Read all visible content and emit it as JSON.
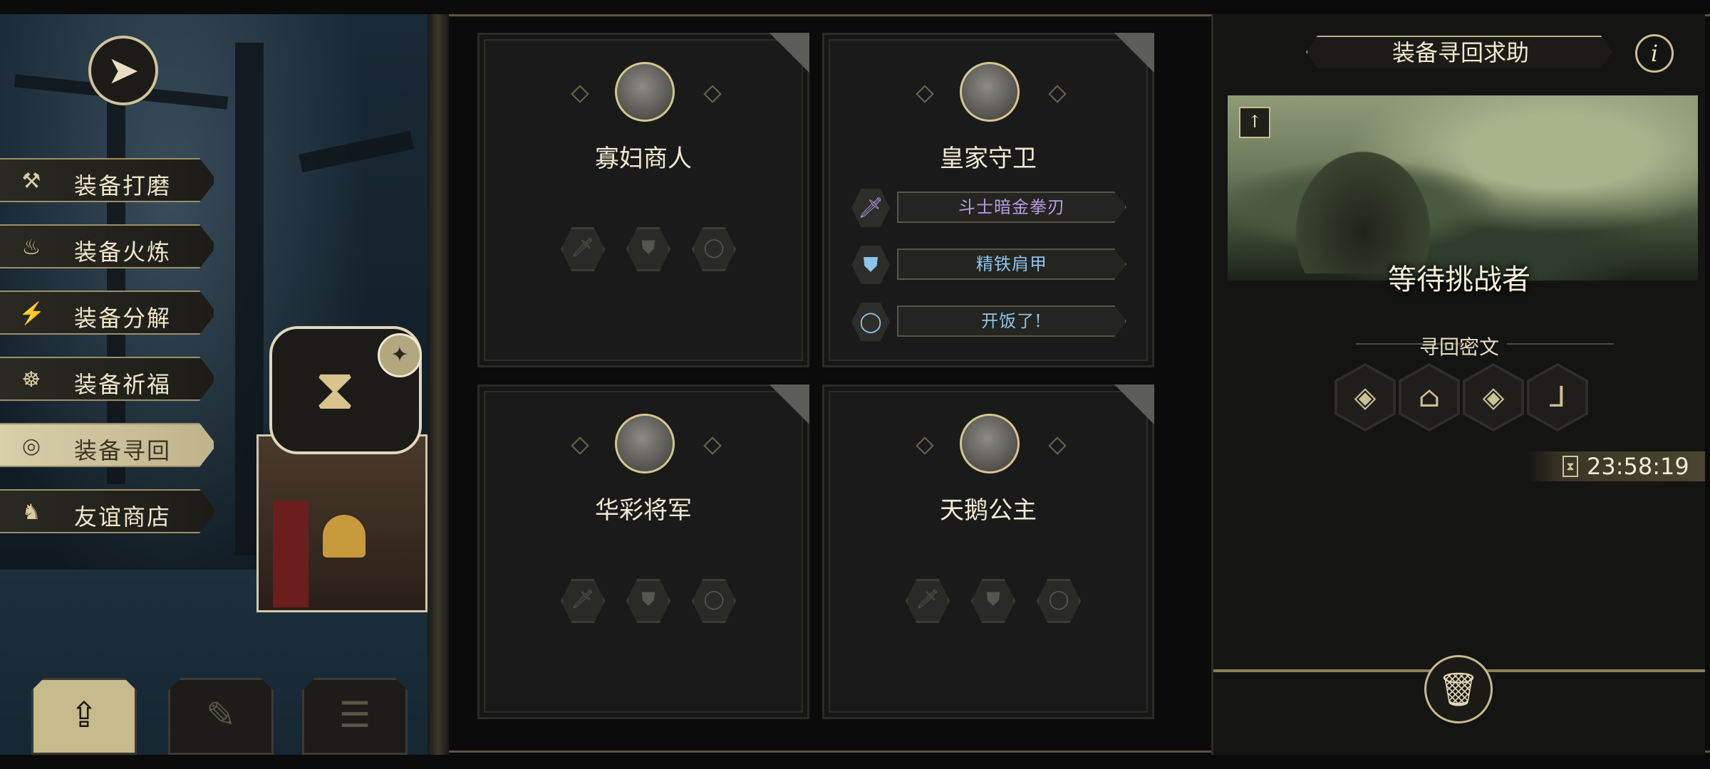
{
  "menu": {
    "items": [
      {
        "label": "装备打磨",
        "icon": "hammer-icon",
        "glyph": "⚒",
        "active": false
      },
      {
        "label": "装备火炼",
        "icon": "flame-icon",
        "glyph": "♨",
        "active": false
      },
      {
        "label": "装备分解",
        "icon": "disassemble-icon",
        "glyph": "⚡",
        "active": false
      },
      {
        "label": "装备祈福",
        "icon": "pray-icon",
        "glyph": "☸",
        "active": false
      },
      {
        "label": "装备寻回",
        "icon": "retrieve-icon",
        "glyph": "◎",
        "active": true
      },
      {
        "label": "友谊商店",
        "icon": "fox-icon",
        "glyph": "♞",
        "active": false
      }
    ],
    "back_icon": "back-arrow-icon",
    "stall_icon": "hourglass-icon",
    "bag_icon": "money-bag-icon"
  },
  "bottom_tabs": [
    {
      "icon": "upload-icon",
      "glyph": "⇪",
      "active": true
    },
    {
      "icon": "feather-icon",
      "glyph": "✎",
      "active": false
    },
    {
      "icon": "list-icon",
      "glyph": "☰",
      "active": false
    }
  ],
  "cards": [
    {
      "name": "寡妇商人",
      "equipment": []
    },
    {
      "name": "皇家守卫",
      "equipment": [
        {
          "label": "斗士暗金拳刃",
          "icon": "sword-icon",
          "glyph": "🗡",
          "color": "#b89be6"
        },
        {
          "label": "精铁肩甲",
          "icon": "armor-icon",
          "glyph": "⛊",
          "color": "#8fc3ea"
        },
        {
          "label": "开饭了!",
          "icon": "ring-icon",
          "glyph": "◯",
          "color": "#8fc3ea"
        }
      ]
    },
    {
      "name": "华彩将军",
      "equipment": []
    },
    {
      "name": "天鹅公主",
      "equipment": []
    }
  ],
  "empty_slots": [
    "sword-slot-icon",
    "armor-slot-icon",
    "ring-slot-icon"
  ],
  "right_panel": {
    "title": "装备寻回求助",
    "info_label": "i",
    "status": "等待挑战者",
    "secret_label": "寻回密文",
    "runes": [
      "◈",
      "⌂",
      "◈",
      "⅃"
    ],
    "timer": "23:58:19",
    "trash_icon": "trash-icon"
  },
  "colors": {
    "gold": "#cdbf93",
    "panel": "#1a1a1a",
    "rare": "#b89be6",
    "uncommon": "#8fc3ea"
  }
}
